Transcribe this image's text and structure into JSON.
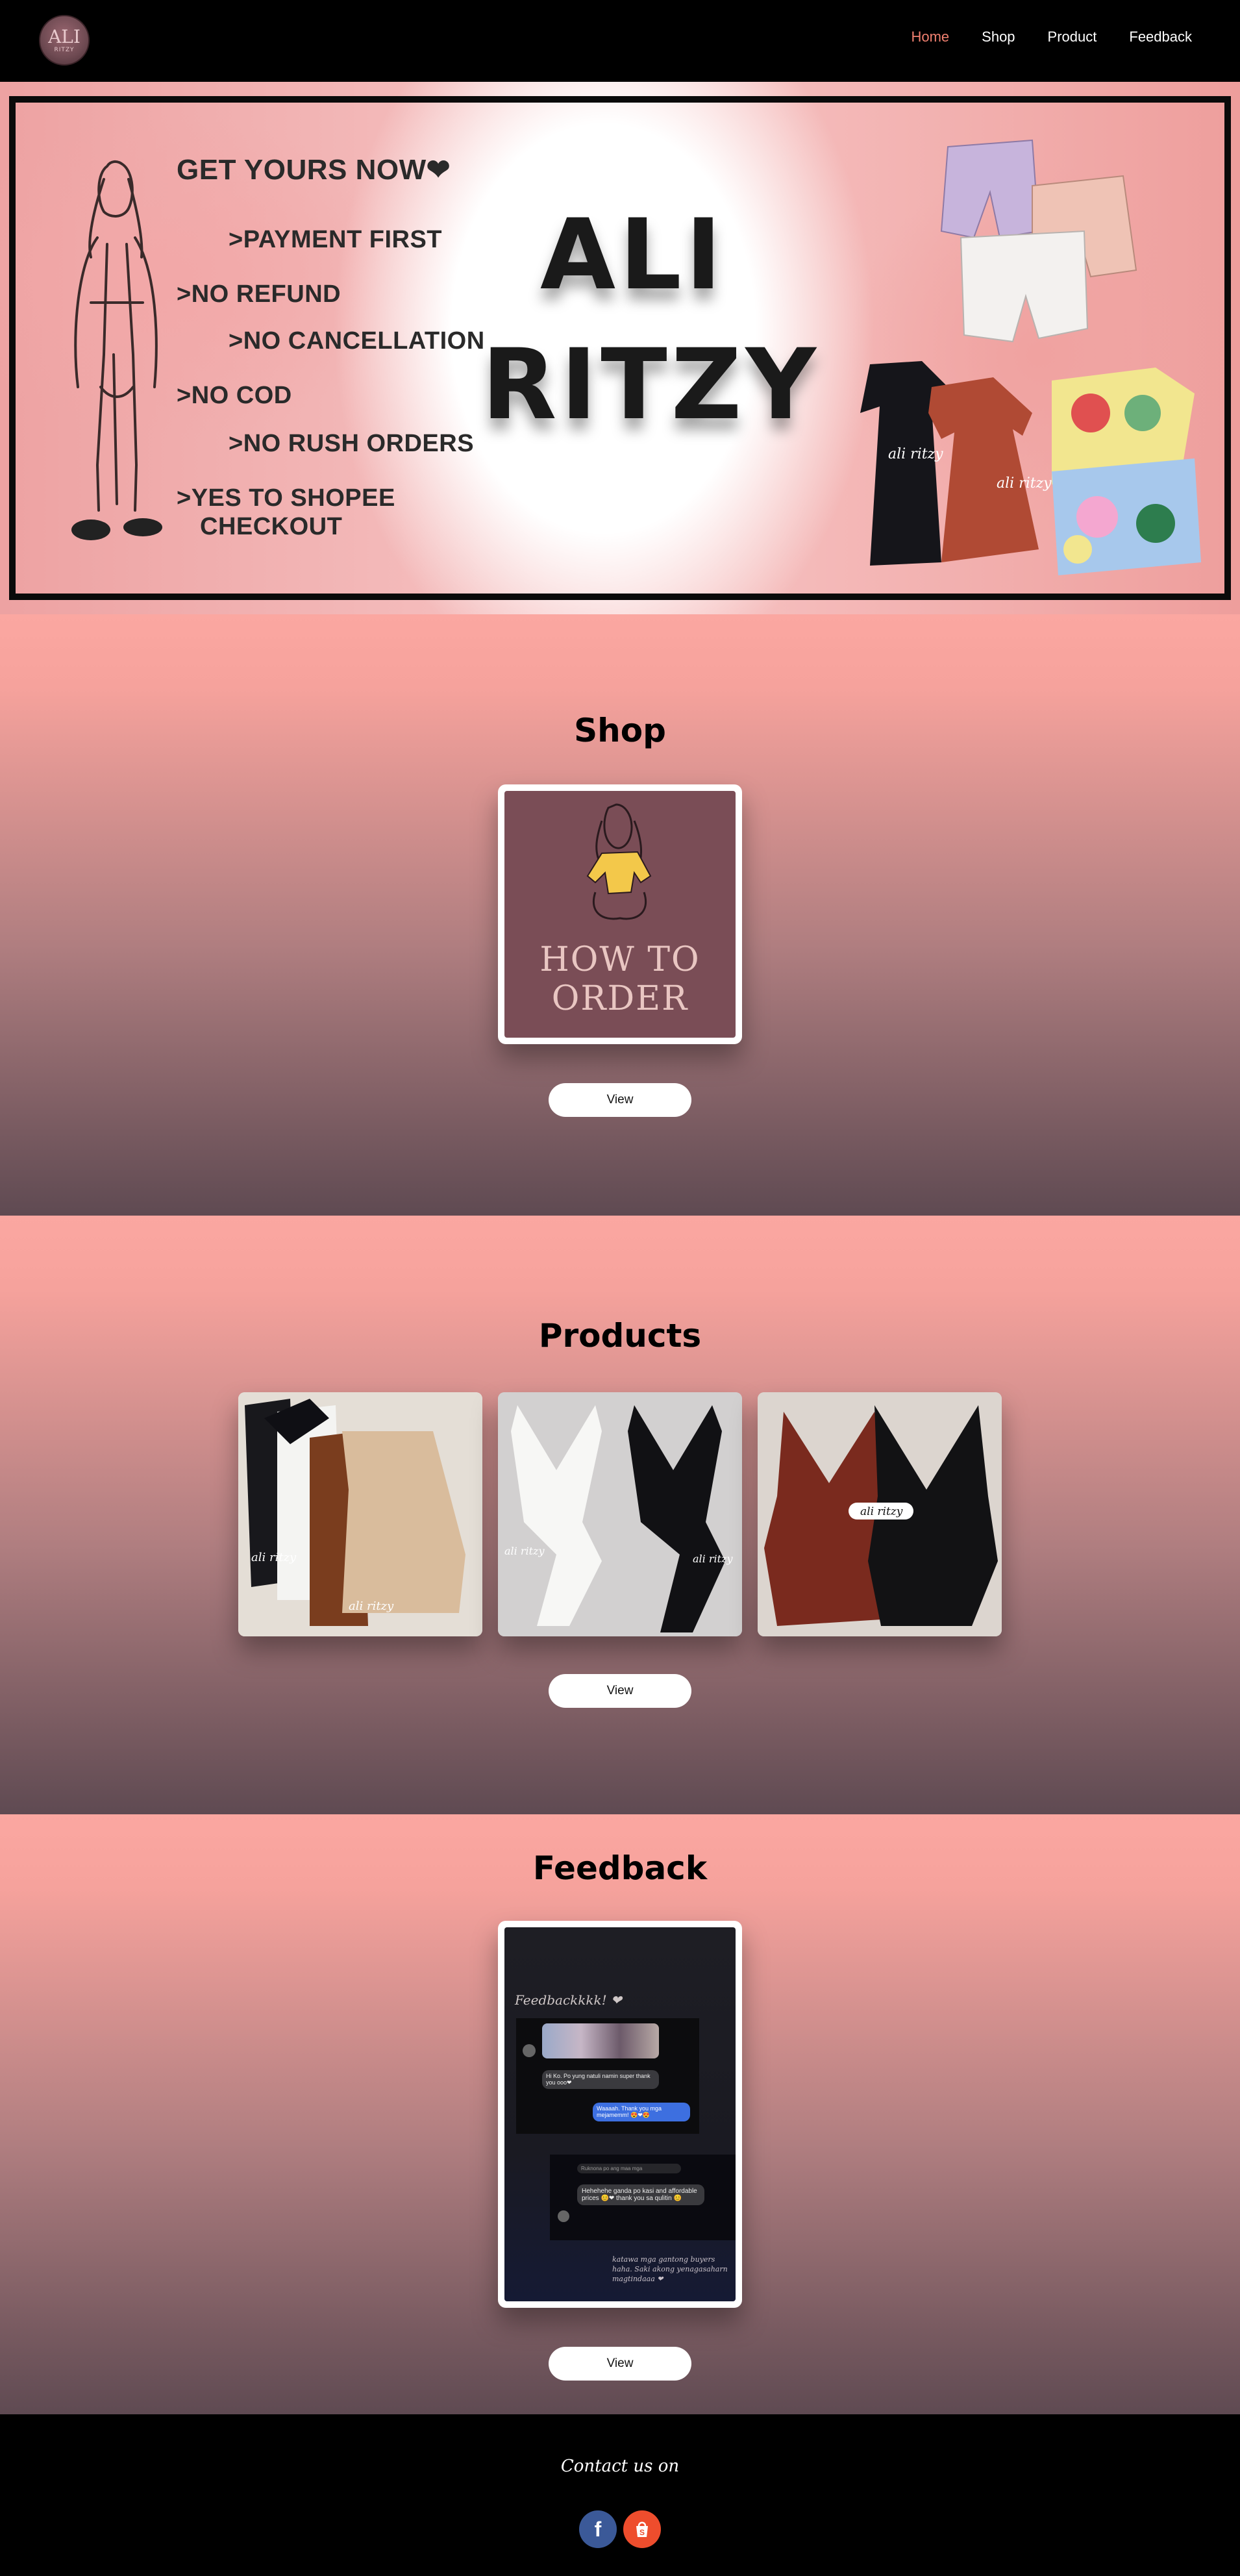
{
  "nav": {
    "logo_text": "ALI",
    "logo_sub": "RITZY",
    "links": [
      "Home",
      "Shop",
      "Product",
      "Feedback"
    ],
    "active": "Home"
  },
  "hero": {
    "headline": "GET YOURS NOW❤",
    "rules": [
      ">PAYMENT FIRST",
      ">NO REFUND",
      ">NO CANCELLATION",
      ">NO COD",
      ">NO RUSH ORDERS",
      ">YES TO SHOPEE",
      "CHECKOUT"
    ],
    "brand_line1": "ALI",
    "brand_line2": "RITZY",
    "tag_text": "ali ritzy"
  },
  "shop": {
    "title": "Shop",
    "card_line1": "HOW TO",
    "card_line2": "ORDER",
    "button": "View"
  },
  "products": {
    "title": "Products",
    "items": [
      {
        "tag": "ali ritzy"
      },
      {
        "tag": "ali ritzy"
      },
      {
        "tag": "ali ritzy"
      }
    ],
    "button": "View"
  },
  "feedback": {
    "title": "Feedback",
    "heading": "Feedbackkkk! ❤",
    "msg1": "Hi Ko. Po yung natuli namin super thank you ooo❤",
    "msg2": "Waaaah. Thank you mga mejamemm! 😍❤😍",
    "msg3_top": "Ruknona po ang maa mga",
    "msg3": "Hehehehe ganda po kasi and affordable prices 😊❤ thank you sa qulitin 😊",
    "note": "katawa mga gantong buyers haha. Saki akong yenagasaharn magtindaaa ❤",
    "button": "View"
  },
  "footer": {
    "contact": "Contact us on"
  },
  "colors": {
    "accent": "#f08070",
    "section_top": "#fba7a1",
    "section_bottom": "#5f4a52",
    "shop_card_bg": "#7a4d56",
    "facebook": "#3b5998",
    "shopee": "#ee4d2d"
  }
}
